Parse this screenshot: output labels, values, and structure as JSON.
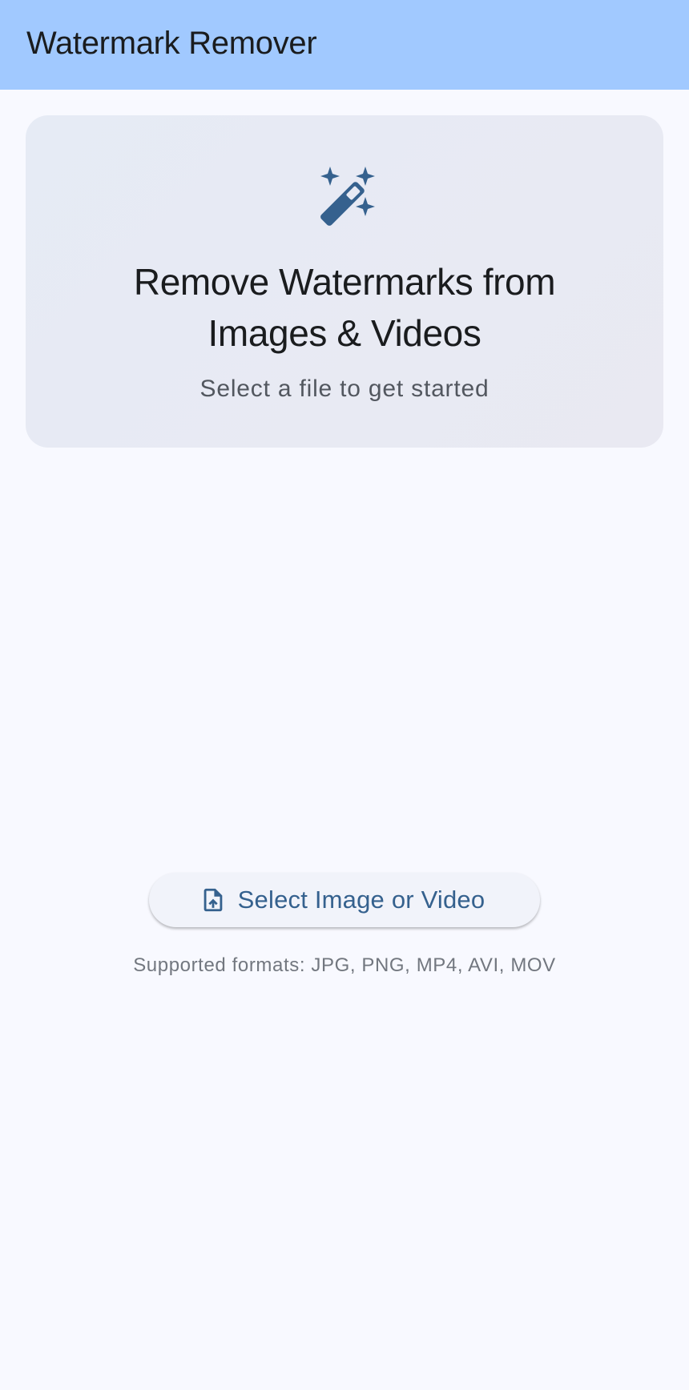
{
  "app_bar": {
    "title": "Watermark Remover"
  },
  "hero": {
    "icon": "magic-wand-icon",
    "title_line1": "Remove Watermarks from",
    "title_line2": "Images & Videos",
    "subtitle": "Select a file to get started"
  },
  "actions": {
    "select_button_icon": "file-upload-icon",
    "select_button_label": "Select Image or Video",
    "supported_formats": "Supported formats: JPG, PNG, MP4, AVI, MOV"
  },
  "colors": {
    "app_bar": "#a1c9ff",
    "background": "#f8f9ff",
    "card": "#e7eaf4",
    "accent": "#35618e"
  }
}
